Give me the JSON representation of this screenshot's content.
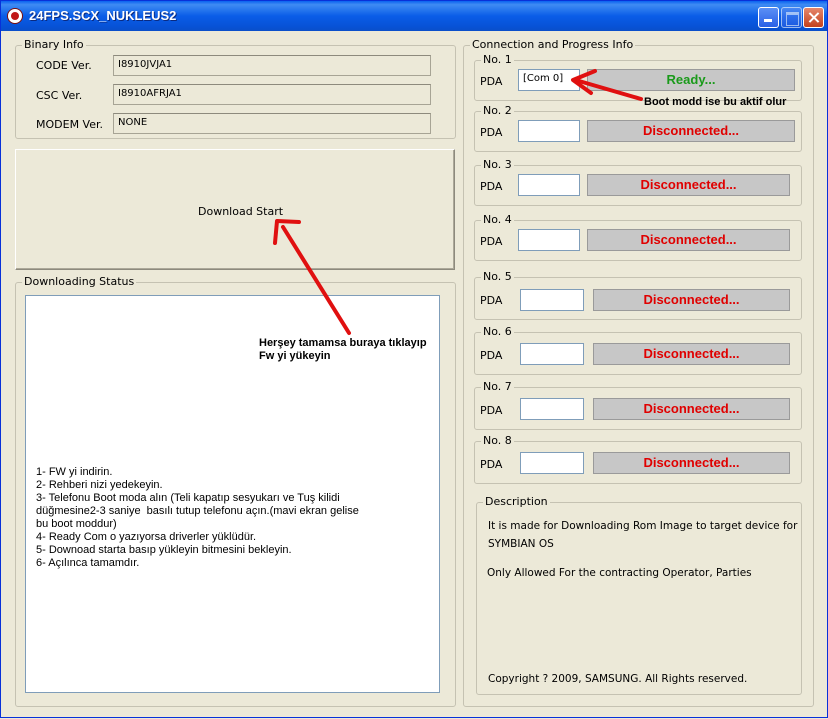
{
  "window": {
    "title": "24FPS.SCX_NUKLEUS2"
  },
  "binary_info": {
    "title": "Binary Info",
    "rows": [
      {
        "label": "CODE Ver.",
        "value": "I8910JVJA1"
      },
      {
        "label": "CSC Ver.",
        "value": "I8910AFRJA1"
      },
      {
        "label": "MODEM Ver.",
        "value": "NONE"
      }
    ]
  },
  "download_button": {
    "label": "Download Start"
  },
  "downloading_status": {
    "title": "Downloading Status",
    "lines": [
      "1- FW yi indirin.",
      "2- Rehberi nizi yedekeyin.",
      "3- Telefonu Boot moda alın (Teli kapatıp sesyukarı ve Tuş kilidi",
      "düğmesine2-3 saniye  basılı tutup telefonu açın.(mavi ekran gelise",
      "bu boot moddur)",
      "4- Ready Com o yazıyorsa driverler yüklüdür.",
      "5- Downoad starta basıp yükleyin bitmesini bekleyin.",
      "6- Açılınca tamamdır."
    ]
  },
  "connection": {
    "title": "Connection and Progress Info",
    "field_label": "PDA",
    "slots": [
      {
        "title": "No. 1",
        "port": "[Com 0]",
        "status": "Ready...",
        "status_color": "#1a9a1a"
      },
      {
        "title": "No. 2",
        "port": "",
        "status": "Disconnected...",
        "status_color": "#e00000"
      },
      {
        "title": "No. 3",
        "port": "",
        "status": "Disconnected...",
        "status_color": "#e00000"
      },
      {
        "title": "No. 4",
        "port": "",
        "status": "Disconnected...",
        "status_color": "#e00000"
      },
      {
        "title": "No. 5",
        "port": "",
        "status": "Disconnected...",
        "status_color": "#e00000"
      },
      {
        "title": "No. 6",
        "port": "",
        "status": "Disconnected...",
        "status_color": "#e00000"
      },
      {
        "title": "No. 7",
        "port": "",
        "status": "Disconnected...",
        "status_color": "#e00000"
      },
      {
        "title": "No. 8",
        "port": "",
        "status": "Disconnected...",
        "status_color": "#e00000"
      }
    ]
  },
  "description": {
    "title": "Description",
    "line1": "It is made for Downloading Rom Image to target device for",
    "line2": "SYMBIAN OS",
    "line3": "Only Allowed For the contracting Operator, Parties",
    "copyright": "Copyright ? 2009, SAMSUNG. All Rights reserved."
  },
  "annotations": {
    "boot_note": "Boot modd ise bu aktif olur",
    "start_note_line1": "Herşey tamamsa buraya tıklayıp",
    "start_note_line2": "Fw yi yükeyin",
    "arrow_color": "#e01010"
  }
}
